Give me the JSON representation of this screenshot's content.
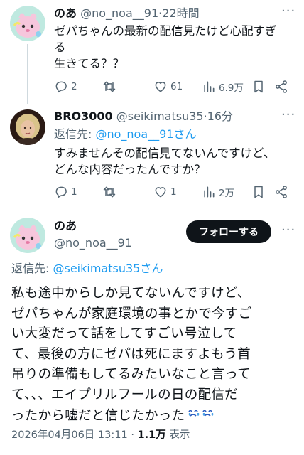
{
  "post1": {
    "name": "のあ",
    "handle": "@no_noa__91",
    "time": "22時間",
    "text_line1": "ゼパちゃんの最新の配信見たけど心配すぎ",
    "text_line2": "る",
    "text_line3": "生きてる？？",
    "replies": "2",
    "retweets": "",
    "likes": "61",
    "views": "6.9万",
    "avatar_icon": "pink-cartoon-avatar-icon"
  },
  "post2": {
    "name": "BRO3000",
    "handle": "@seikimatsu35",
    "time": "16分",
    "reply_prefix": "返信先: ",
    "reply_target": "@no_noa__91さん",
    "text_line1": "すみませんその配信見てないんですけど、",
    "text_line2": "どんな内容だったんですか？",
    "replies": "1",
    "retweets": "",
    "likes": "1",
    "views": "2万",
    "avatar_icon": "person-photo-avatar-icon"
  },
  "post3": {
    "name": "のあ",
    "handle": "@no_noa__91",
    "follow_label": "フォローする",
    "reply_prefix": "返信先: ",
    "reply_target": "@seikimatsu35さん",
    "text_line1": "私も途中からしか見てないんですけど、",
    "text_line2": "ゼパちゃんが家庭環境の事とかで今すご",
    "text_line3": "い大変だって話をしてすごい号泣して",
    "text_line4": "て、最後の方にゼパは死にますよもう首",
    "text_line5": "吊りの準備もしてるみたいなこと言って",
    "text_line6": "て、、、エイプリルフールの日の配信だ",
    "text_line7": "ったから嘘だと信じたかった",
    "date": "2026年04月06日 13:11",
    "views_count": "1.1万",
    "views_label": "表示"
  },
  "icons": {
    "emoji": "crying-face-emoji",
    "more": "more-options-icon",
    "reply": "reply-icon",
    "retweet": "retweet-icon",
    "like": "heart-icon",
    "views": "views-chart-icon",
    "bookmark": "bookmark-icon",
    "share": "share-icon"
  },
  "colors": {
    "link": "#1d9bf0",
    "secondary_text": "#536471",
    "follow_button": "#0f1419"
  }
}
